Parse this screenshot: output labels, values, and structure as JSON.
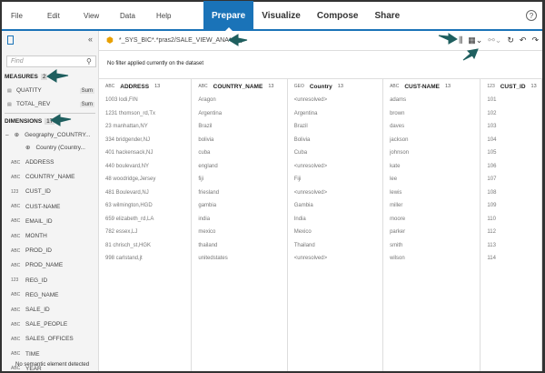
{
  "menu": [
    "File",
    "Edit",
    "View",
    "Data",
    "Help"
  ],
  "tabs": [
    "Prepare",
    "Visualize",
    "Compose",
    "Share"
  ],
  "help_icon": "?",
  "sidebar": {
    "find_placeholder": "Find",
    "measures_label": "MEASURES",
    "measures_count": "2",
    "measures": [
      {
        "name": "QUATITY",
        "agg": "Sum"
      },
      {
        "name": "TOTAL_REV",
        "agg": "Sum"
      }
    ],
    "dimensions_label": "DIMENSIONS",
    "dimensions_count": "17",
    "geo": "Geography_COUNTRY...",
    "geo_child": "Country (Country...",
    "dimensions": [
      {
        "t": "ABC",
        "n": "ADDRESS"
      },
      {
        "t": "ABC",
        "n": "COUNTRY_NAME"
      },
      {
        "t": "123",
        "n": "CUST_ID"
      },
      {
        "t": "ABC",
        "n": "CUST-NAME"
      },
      {
        "t": "ABC",
        "n": "EMAIL_ID"
      },
      {
        "t": "ABC",
        "n": "MONTH"
      },
      {
        "t": "ABC",
        "n": "PROD_ID"
      },
      {
        "t": "ABC",
        "n": "PROD_NAME"
      },
      {
        "t": "123",
        "n": "REG_ID"
      },
      {
        "t": "ABC",
        "n": "REG_NAME"
      },
      {
        "t": "ABC",
        "n": "SALE_ID"
      },
      {
        "t": "ABC",
        "n": "SALE_PEOPLE"
      },
      {
        "t": "ABC",
        "n": "SALES_OFFICES"
      },
      {
        "t": "ABC",
        "n": "TIME"
      },
      {
        "t": "ABC",
        "n": "YEAR"
      }
    ],
    "footer": "No semantic element detected"
  },
  "dataset": "*_SYS_BIC*.*pras2/SALE_VIEW_ANA*",
  "filter_text": "No filter applied currently on the dataset",
  "columns": [
    {
      "type": "ABC",
      "name": "ADDRESS",
      "count": "13",
      "values": [
        "1003 lodi,FIN",
        "1231 thomson_rd,Tx",
        "23 manhattan,NY",
        "334 bridgender,NJ",
        "401 hackensack,NJ",
        "440 boulevard,NY",
        "48 woodridge,Jersey",
        "481 Boulevard,NJ",
        "63 wilmington,HGD",
        "659 elizabeth_rd,LA",
        "782 essex,LJ",
        "81 chrisch_st,HGK",
        "998 carlstand,jt"
      ]
    },
    {
      "type": "ABC",
      "name": "COUNTRY_NAME",
      "count": "13",
      "values": [
        "Aragon",
        "Argentina",
        "Brazil",
        "bolivia",
        "cuba",
        "england",
        "fiji",
        "friesland",
        "gambia",
        "india",
        "mexico",
        "thailand",
        "unitedstates"
      ]
    },
    {
      "type": "GEO",
      "name": "Country",
      "count": "13",
      "values": [
        "<unresolved>",
        "Argentina",
        "Brazil",
        "Bolivia",
        "Cuba",
        "<unresolved>",
        "Fiji",
        "<unresolved>",
        "Gambia",
        "India",
        "Mexico",
        "Thailand",
        "<unresolved>"
      ]
    },
    {
      "type": "ABC",
      "name": "CUST-NAME",
      "count": "13",
      "values": [
        "adams",
        "brown",
        "daves",
        "jackson",
        "johnson",
        "kate",
        "lee",
        "lewis",
        "miller",
        "moore",
        "parker",
        "smith",
        "wilson"
      ]
    },
    {
      "type": "123",
      "name": "CUST_ID",
      "count": "13",
      "values": [
        "101",
        "102",
        "103",
        "104",
        "105",
        "106",
        "107",
        "108",
        "109",
        "110",
        "112",
        "113",
        "114"
      ]
    }
  ],
  "colors": {
    "accent": "#1a73b8",
    "arrow": "#1f5f5f"
  }
}
